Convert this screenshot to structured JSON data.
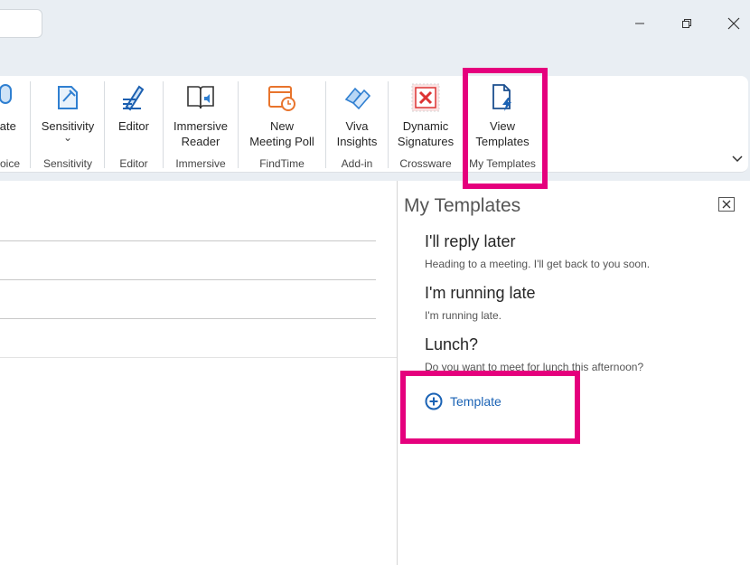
{
  "window": {
    "minimize": "—",
    "maximize": "▢",
    "close": "✕"
  },
  "ribbon": {
    "groups": [
      {
        "id": "voice",
        "button_label": "tate",
        "group_label": "oice"
      },
      {
        "id": "sensitivity",
        "button_label": "Sensitivity",
        "group_label": "Sensitivity"
      },
      {
        "id": "editor",
        "button_label": "Editor",
        "group_label": "Editor"
      },
      {
        "id": "immersive",
        "button_label": "Immersive\nReader",
        "group_label": "Immersive"
      },
      {
        "id": "findtime",
        "button_label": "New\nMeeting Poll",
        "group_label": "FindTime"
      },
      {
        "id": "addin",
        "button_label": "Viva\nInsights",
        "group_label": "Add-in"
      },
      {
        "id": "crossware",
        "button_label": "Dynamic\nSignatures",
        "group_label": "Crossware"
      },
      {
        "id": "mytemplates",
        "button_label": "View\nTemplates",
        "group_label": "My Templates"
      }
    ],
    "sensitivity_dropdown": "⌄",
    "expand_icon": "⌄"
  },
  "templates_pane": {
    "title": "My Templates",
    "items": [
      {
        "title": "I'll reply later",
        "desc": "Heading to a meeting. I'll get back to you soon."
      },
      {
        "title": "I'm running late",
        "desc": "I'm running late."
      },
      {
        "title": "Lunch?",
        "desc": "Do you want to meet for lunch this afternoon?"
      }
    ],
    "add_label": "Template"
  },
  "colors": {
    "accent": "#1b63b5",
    "highlight": "#e5007d",
    "findtime": "#e8742c"
  }
}
